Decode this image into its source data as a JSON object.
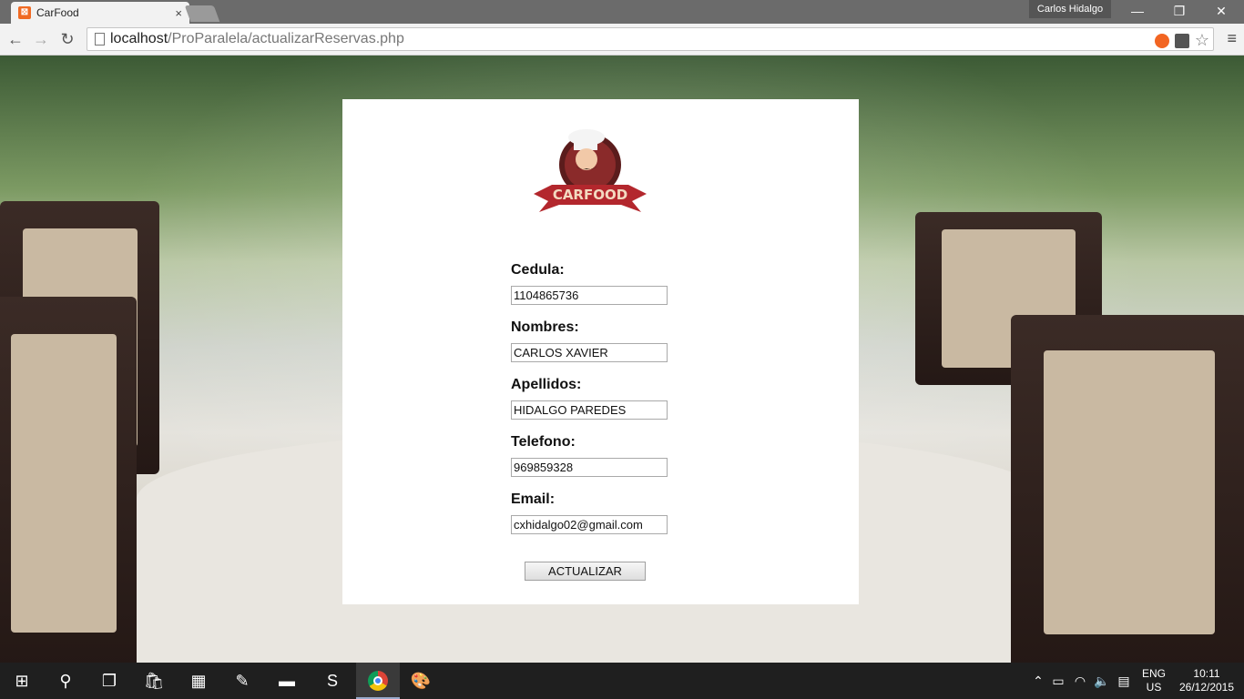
{
  "browser": {
    "tab_title": "CarFood",
    "tab_close": "×",
    "profile_name": "Carlos Hidalgo",
    "url_host": "localhost",
    "url_path": "/ProParalela/actualizarReservas.php",
    "window_controls": {
      "minimize": "—",
      "restore": "❐",
      "close": "✕"
    },
    "nav": {
      "back": "←",
      "forward": "→",
      "reload": "↻",
      "star": "☆",
      "menu": "≡"
    }
  },
  "logo": {
    "text": "CARFOOD"
  },
  "form": {
    "fields": [
      {
        "label": "Cedula:",
        "value": "1104865736"
      },
      {
        "label": "Nombres:",
        "value": "CARLOS XAVIER"
      },
      {
        "label": "Apellidos:",
        "value": "HIDALGO PAREDES"
      },
      {
        "label": "Telefono:",
        "value": "969859328"
      },
      {
        "label": "Email:",
        "value": "cxhidalgo02@gmail.com"
      }
    ],
    "submit_label": "ACTUALIZAR"
  },
  "taskbar": {
    "lang_line1": "ENG",
    "lang_line2": "US",
    "time": "10:11",
    "date": "26/12/2015"
  }
}
